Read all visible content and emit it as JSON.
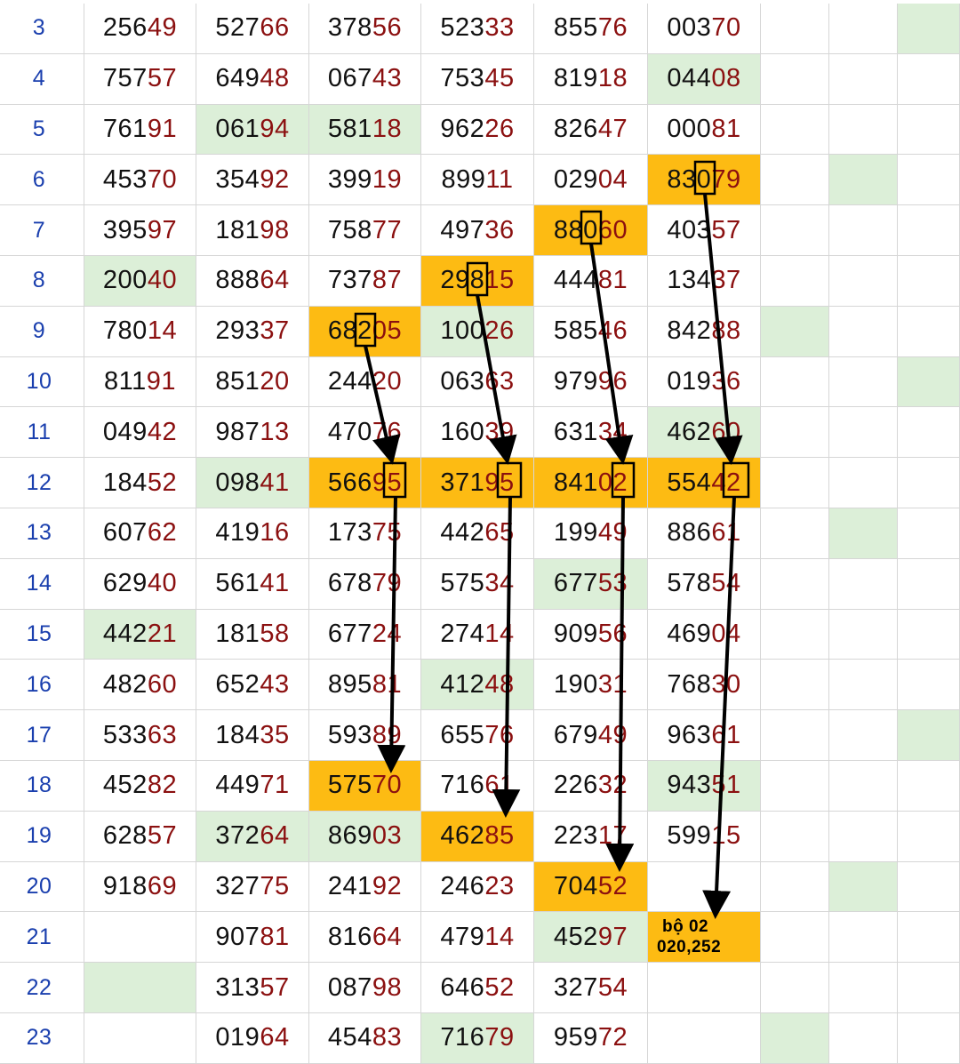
{
  "colors": {
    "highlight_orange": "#fdbb13",
    "highlight_green": "#dcefd8",
    "head_digits": "#111111",
    "tail_digits": "#8b1010",
    "row_number": "#1a3fae",
    "arrow": "#000000"
  },
  "rows": [
    {
      "label": "3",
      "cells": [
        "25649",
        "52766",
        "37856",
        "52333",
        "85576",
        "00370",
        "",
        "",
        ""
      ],
      "fill": [
        "",
        "",
        "",
        "",
        "",
        "",
        "",
        "",
        "green"
      ]
    },
    {
      "label": "4",
      "cells": [
        "75757",
        "64948",
        "06743",
        "75345",
        "81918",
        "04408",
        "",
        "",
        ""
      ],
      "fill": [
        "",
        "",
        "",
        "",
        "",
        "green",
        "",
        "",
        ""
      ]
    },
    {
      "label": "5",
      "cells": [
        "76191",
        "06194",
        "58118",
        "96226",
        "82647",
        "00081",
        "",
        "",
        ""
      ],
      "fill": [
        "",
        "green",
        "green",
        "",
        "",
        "",
        "",
        "",
        ""
      ]
    },
    {
      "label": "6",
      "cells": [
        "45370",
        "35492",
        "39919",
        "89911",
        "02904",
        "83079",
        "",
        "",
        ""
      ],
      "fill": [
        "",
        "",
        "",
        "",
        "",
        "orange",
        "",
        "green",
        ""
      ]
    },
    {
      "label": "7",
      "cells": [
        "39597",
        "18198",
        "75877",
        "49736",
        "88060",
        "40357",
        "",
        "",
        ""
      ],
      "fill": [
        "",
        "",
        "",
        "",
        "orange",
        "",
        "",
        "",
        ""
      ]
    },
    {
      "label": "8",
      "cells": [
        "20040",
        "88864",
        "73787",
        "29815",
        "44481",
        "13437",
        "",
        "",
        ""
      ],
      "fill": [
        "green",
        "",
        "",
        "orange",
        "",
        "",
        "",
        "",
        ""
      ]
    },
    {
      "label": "9",
      "cells": [
        "78014",
        "29337",
        "68205",
        "10026",
        "58546",
        "84288",
        "",
        "",
        ""
      ],
      "fill": [
        "",
        "",
        "orange",
        "green",
        "",
        "",
        "green",
        "",
        ""
      ]
    },
    {
      "label": "10",
      "cells": [
        "81191",
        "85120",
        "24420",
        "06363",
        "97996",
        "01936",
        "",
        "",
        ""
      ],
      "fill": [
        "",
        "",
        "",
        "",
        "",
        "",
        "",
        "",
        "green"
      ]
    },
    {
      "label": "11",
      "cells": [
        "04942",
        "98713",
        "47076",
        "16039",
        "63134",
        "46260",
        "",
        "",
        ""
      ],
      "fill": [
        "",
        "",
        "",
        "",
        "",
        "green",
        "",
        "",
        ""
      ]
    },
    {
      "label": "12",
      "cells": [
        "18452",
        "09841",
        "56695",
        "37195",
        "84102",
        "55442",
        "",
        "",
        ""
      ],
      "fill": [
        "",
        "green",
        "orange",
        "orange",
        "orange",
        "orange",
        "",
        "",
        ""
      ]
    },
    {
      "label": "13",
      "cells": [
        "60762",
        "41916",
        "17375",
        "44265",
        "19949",
        "88661",
        "",
        "",
        ""
      ],
      "fill": [
        "",
        "",
        "",
        "",
        "",
        "",
        "",
        "green",
        ""
      ]
    },
    {
      "label": "14",
      "cells": [
        "62940",
        "56141",
        "67879",
        "57534",
        "67753",
        "57854",
        "",
        "",
        ""
      ],
      "fill": [
        "",
        "",
        "",
        "",
        "green",
        "",
        "",
        "",
        ""
      ]
    },
    {
      "label": "15",
      "cells": [
        "44221",
        "18158",
        "67724",
        "27414",
        "90956",
        "46904",
        "",
        "",
        ""
      ],
      "fill": [
        "green",
        "",
        "",
        "",
        "",
        "",
        "",
        "",
        ""
      ]
    },
    {
      "label": "16",
      "cells": [
        "48260",
        "65243",
        "89581",
        "41248",
        "19031",
        "76830",
        "",
        "",
        ""
      ],
      "fill": [
        "",
        "",
        "",
        "green",
        "",
        "",
        "",
        "",
        ""
      ]
    },
    {
      "label": "17",
      "cells": [
        "53363",
        "18435",
        "59389",
        "65576",
        "67949",
        "96361",
        "",
        "",
        ""
      ],
      "fill": [
        "",
        "",
        "",
        "",
        "",
        "",
        "",
        "",
        "green"
      ]
    },
    {
      "label": "18",
      "cells": [
        "45282",
        "44971",
        "57570",
        "71661",
        "22632",
        "94351",
        "",
        "",
        ""
      ],
      "fill": [
        "",
        "",
        "orange",
        "",
        "",
        "green",
        "",
        "",
        ""
      ]
    },
    {
      "label": "19",
      "cells": [
        "62857",
        "37264",
        "86903",
        "46285",
        "22317",
        "59915",
        "",
        "",
        ""
      ],
      "fill": [
        "",
        "green",
        "green",
        "orange",
        "",
        "",
        "",
        "",
        ""
      ]
    },
    {
      "label": "20",
      "cells": [
        "91869",
        "32775",
        "24192",
        "24623",
        "70452",
        "",
        "",
        "",
        ""
      ],
      "fill": [
        "",
        "",
        "",
        "",
        "orange",
        "",
        "",
        "green",
        ""
      ]
    },
    {
      "label": "21",
      "cells": [
        "",
        "90781",
        "81664",
        "47914",
        "45297",
        "",
        "",
        "",
        ""
      ],
      "fill": [
        "",
        "",
        "",
        "",
        "green",
        "orange",
        "",
        "",
        ""
      ]
    },
    {
      "label": "22",
      "cells": [
        "",
        "31357",
        "08798",
        "64652",
        "32754",
        "",
        "",
        "",
        ""
      ],
      "fill": [
        "green",
        "",
        "",
        "",
        "",
        "",
        "",
        "",
        ""
      ]
    },
    {
      "label": "23",
      "cells": [
        "",
        "01964",
        "45483",
        "71679",
        "95972",
        "",
        "",
        "",
        ""
      ],
      "fill": [
        "",
        "",
        "",
        "green",
        "",
        "",
        "green",
        "",
        ""
      ]
    }
  ],
  "note": {
    "line1": "bộ 02",
    "line2": "020,252"
  }
}
